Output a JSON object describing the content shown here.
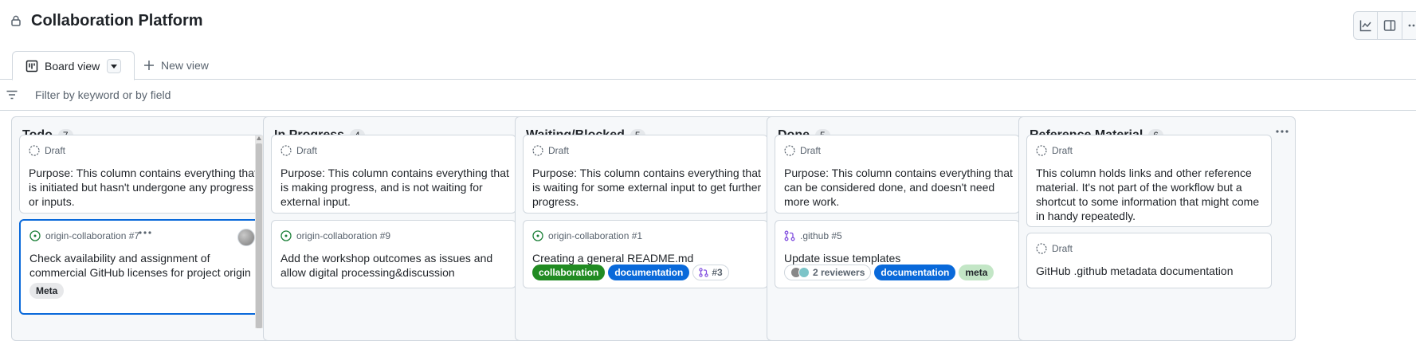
{
  "header": {
    "title": "Collaboration Platform"
  },
  "tabs": {
    "active_label": "Board view",
    "new_view_label": "New view"
  },
  "filter": {
    "placeholder": "Filter by keyword or by field"
  },
  "colors": {
    "accent": "#0969da",
    "draft_gray": "#59636e",
    "open_green": "#1a7f37",
    "pr_purple": "#8250df",
    "label_collaboration": "#218b22",
    "label_documentation": "#0969da",
    "label_meta": "#c3e6c6"
  },
  "columns": [
    {
      "name": "Todo",
      "count": "7",
      "cards": [
        {
          "type": "draft",
          "meta": "Draft",
          "text": "Purpose: This column contains everything that is initiated but hasn't undergone any progress or inputs."
        },
        {
          "type": "issue",
          "meta": "origin-collaboration #7",
          "text": "Check availability and assignment of commercial GitHub licenses for project origin",
          "labels": [
            "Meta"
          ]
        }
      ]
    },
    {
      "name": "In Progress",
      "count": "4",
      "cards": [
        {
          "type": "draft",
          "meta": "Draft",
          "text": "Purpose: This column contains everything that is making progress, and is not waiting for external input."
        },
        {
          "type": "issue",
          "meta": "origin-collaboration #9",
          "text": "Add the workshop outcomes as issues and allow digital processing&discussion"
        }
      ]
    },
    {
      "name": "Waiting/Blocked",
      "count": "5",
      "cards": [
        {
          "type": "draft",
          "meta": "Draft",
          "text": "Purpose: This column contains everything that is waiting for some external input to get further progress."
        },
        {
          "type": "issue",
          "meta": "origin-collaboration #1",
          "text": "Creating a general README.md",
          "labels": [
            "collaboration",
            "documentation"
          ],
          "linked_pr": "#3"
        }
      ]
    },
    {
      "name": "Done",
      "count": "5",
      "cards": [
        {
          "type": "draft",
          "meta": "Draft",
          "text": "Purpose: This column contains everything that can be considered done, and doesn't need more work."
        },
        {
          "type": "pr",
          "meta": ".github #5",
          "text": "Update issue templates",
          "reviewers": "2 reviewers",
          "labels": [
            "documentation",
            "meta"
          ]
        }
      ]
    },
    {
      "name": "Reference Material",
      "count": "6",
      "cards": [
        {
          "type": "draft",
          "meta": "Draft",
          "text": "This column holds links and other reference material. It's not part of the workflow but a shortcut to some information that might come in handy repeatedly."
        },
        {
          "type": "draft",
          "meta": "Draft",
          "text": "GitHub .github metadata documentation"
        }
      ]
    }
  ]
}
